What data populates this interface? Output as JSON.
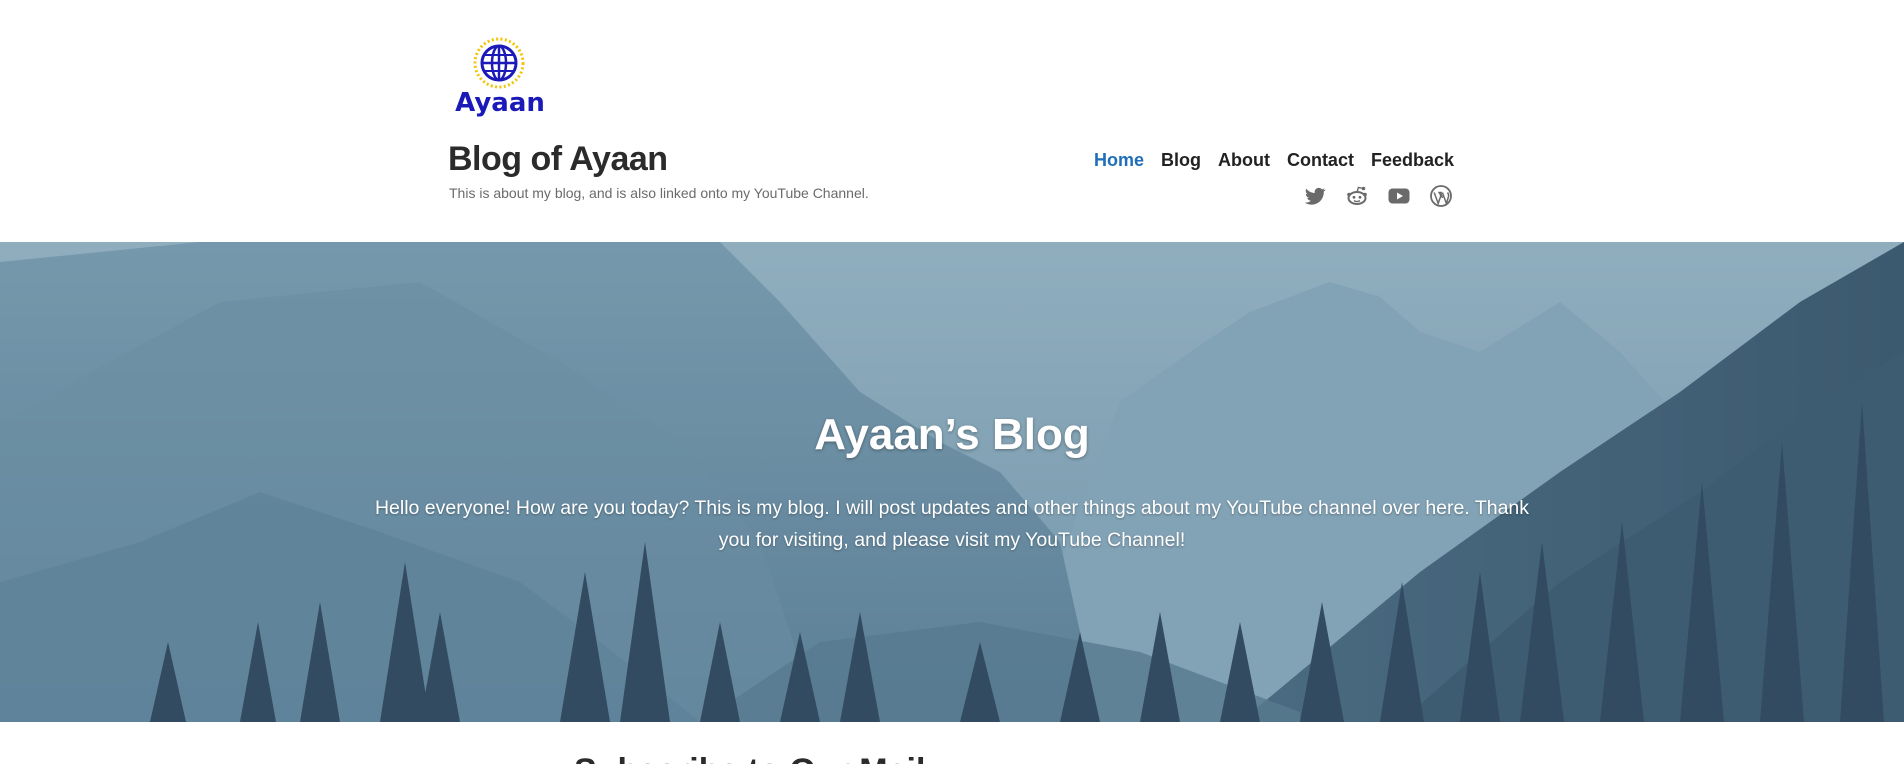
{
  "logo": {
    "text": "Ayaan",
    "ring_color": "#f2c500",
    "globe_color": "#1b1ab8"
  },
  "site": {
    "title": "Blog of Ayaan",
    "tagline": "This is about my blog, and is also linked onto my YouTube Channel."
  },
  "nav": {
    "items": [
      {
        "label": "Home",
        "current": true
      },
      {
        "label": "Blog"
      },
      {
        "label": "About"
      },
      {
        "label": "Contact"
      },
      {
        "label": "Feedback"
      }
    ],
    "current_color": "#1e6fb8"
  },
  "social": {
    "icons": [
      "twitter-icon",
      "reddit-icon",
      "youtube-icon",
      "wordpress-icon"
    ],
    "color": "#6a6a6a"
  },
  "hero": {
    "title": "Ayaan’s Blog",
    "text": "Hello everyone! How are you today? This is my blog. I will post updates and other things about my YouTube channel over here. Thank you for visiting, and please visit my YouTube Channel!"
  },
  "below": {
    "heading": "Subscribe to Our Mail..."
  }
}
